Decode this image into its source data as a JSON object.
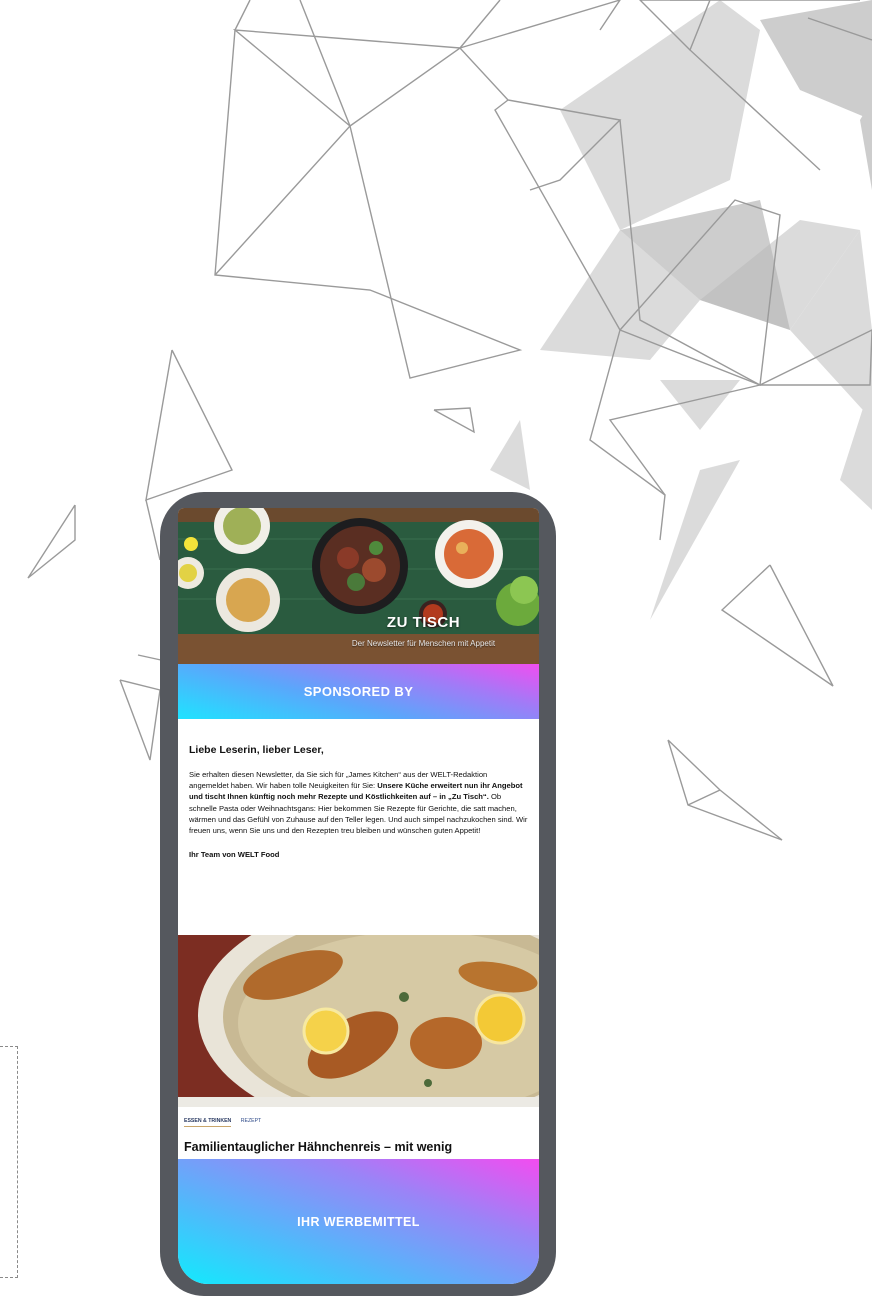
{
  "newsletter": {
    "title": "ZU TISCH",
    "subtitle": "Der Newsletter für Menschen mit Appetit"
  },
  "sponsor": {
    "label": "SPONSORED BY"
  },
  "letter": {
    "greeting": "Liebe Leserin, lieber Leser,",
    "p1": "Sie erhalten diesen Newsletter, da Sie sich für „James Kitchen“ aus der WELT-Redaktion angemeldet haben. Wir haben tolle Neuigkeiten für Sie: ",
    "p1_bold": "Unsere Küche erweitert nun ihr Angebot und tischt Ihnen künftig noch mehr Rezepte und Köstlichkeiten auf – in „Zu Tisch“.",
    "p1_end": " Ob schnelle Pasta oder Weihnachtsgans: Hier bekommen Sie Rezepte für Gerichte, die satt machen, wärmen und das Gefühl von Zuhause auf den Teller legen. Und auch simpel nachzukochen sind. Wir freuen uns, wenn Sie uns und den Rezepten treu bleiben und wünschen guten Appetit!",
    "signoff": "Ihr Team von WELT Food"
  },
  "article": {
    "tag_primary": "ESSEN & TRINKEN",
    "tag_secondary": "REZEPT",
    "title": "Familientauglicher Hähnchenreis – mit wenig"
  },
  "ad": {
    "label": "IHR WERBEMITTEL"
  },
  "colors": {
    "phone_frame": "#55585e",
    "gradient_cyan": "#1fe3ff",
    "gradient_magenta": "#f04ef0",
    "banner_green": "#2a5b3f"
  }
}
